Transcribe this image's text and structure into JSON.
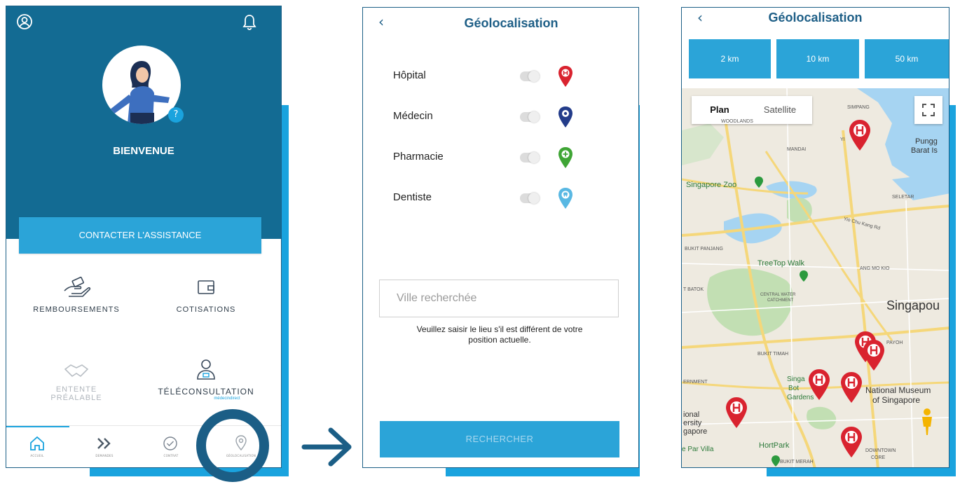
{
  "screen_home": {
    "welcome": "BIENVENUE",
    "contact_button": "CONTACTER L'ASSISTANCE",
    "tiles": [
      {
        "label": "REMBOURSEMENTS",
        "icon": "hand-money-icon"
      },
      {
        "label": "COTISATIONS",
        "icon": "wallet-icon"
      },
      {
        "label": "ENTENTE PRÉALABLE",
        "line1": "ENTENTE",
        "line2": "PRÉALABLE",
        "icon": "handshake-icon"
      },
      {
        "label": "TÉLÉCONSULTATION",
        "sub": "médecindirect",
        "icon": "doctor-icon"
      }
    ],
    "nav": [
      {
        "label": "ACCUEIL",
        "icon": "home-icon"
      },
      {
        "label": "DEMANDES",
        "icon": "double-chevron-icon"
      },
      {
        "label": "CONTRAT",
        "icon": "check-circle-icon"
      },
      {
        "label": "GÉOLOCALISATION",
        "icon": "location-pin-icon"
      }
    ],
    "colors": {
      "header": "#136b93",
      "accent": "#1aa3de"
    }
  },
  "screen_filters": {
    "title": "Géolocalisation",
    "back_icon": "chevron-left-icon",
    "filters": [
      {
        "label": "Hôpital",
        "pin_color": "#d9232f",
        "enabled": false
      },
      {
        "label": "Médecin",
        "pin_color": "#233c8a",
        "enabled": false
      },
      {
        "label": "Pharmacie",
        "pin_color": "#3fa535",
        "enabled": false
      },
      {
        "label": "Dentiste",
        "pin_color": "#59b8e3",
        "enabled": false
      }
    ],
    "city_placeholder": "Ville recherchée",
    "hint": "Veuillez saisir le lieu s'il est différent de votre position actuelle.",
    "hint_line1": "Veuillez saisir le lieu s'il est différent de votre",
    "hint_line2": "position actuelle.",
    "search_button": "RECHERCHER"
  },
  "screen_map": {
    "title": "Géolocalisation",
    "distances": [
      "2 km",
      "10 km",
      "50 km"
    ],
    "map_types": [
      "Plan",
      "Satellite"
    ],
    "map_labels": {
      "singapore_zoo": "Singapore Zoo",
      "treetop_walk": "TreeTop Walk",
      "singapore": "Singapou",
      "national_museum": "National Museum",
      "national_museum_2": "of Singapore",
      "hortpark": "HortPark",
      "pungg": "Pungg",
      "barat": "Barat Is",
      "woodlands": "WOODLANDS",
      "mandai": "MANDAI",
      "seletar": "SELETAR",
      "bukit_panjang": "BUKIT PANJANG",
      "ang_mo_kio": "ANG MO KIO",
      "central_water": "CENTRAL WATER",
      "catchment": "CATCHMENT",
      "bukit_timah": "BUKIT TIMAH",
      "yio_chu_kang": "Yio Chu Kang Rd",
      "sing_bot": "Singa",
      "botanic": "Bot",
      "gardens": "Gardens",
      "ernment": "ERNMENT",
      "ional": "ional",
      "ersity": "ersity",
      "gapore": "gapore",
      "par_villa": "e Par Villa",
      "bukit_merah": "BUKIT MERAH",
      "downtown": "DOWNTOWN",
      "core": "CORE",
      "payoh": "PAYOH",
      "bukit_batok": "T BATOK",
      "simpang": "SIMPANG",
      "yishun": "YI"
    }
  }
}
